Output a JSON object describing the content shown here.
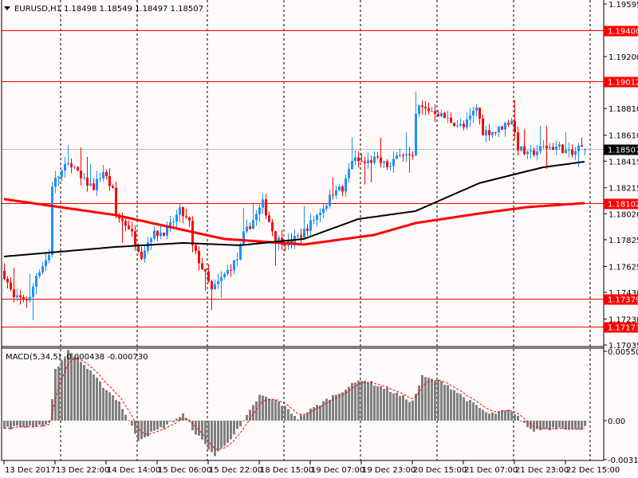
{
  "header": {
    "symbol": "EURUSD,H1",
    "ohlc": "1.18498 1.18549 1.18497 1.18507",
    "menu_icon": "triangle-down-icon"
  },
  "colors": {
    "background": "#fffafa",
    "bull": "#1e90ff",
    "bear": "#ff0000",
    "level": "#ff0000",
    "ma_slow": "#ff0000",
    "ma_fast": "#000000",
    "macd_hist": "#808080",
    "macd_signal": "#ff0000",
    "current_price": "#c0c0c0"
  },
  "chart_data": {
    "type": "candlestick",
    "symbol": "EURUSD",
    "timeframe": "H1",
    "bars": 183,
    "ylim": [
      1.17035,
      1.19595
    ],
    "y_ticks": [
      "1.19595",
      "1.19200",
      "1.18810",
      "1.18610",
      "1.18415",
      "1.18215",
      "1.18020",
      "1.17825",
      "1.17625",
      "1.17430",
      "1.17230",
      "1.17035"
    ],
    "x_ticks": [
      {
        "bar": 0,
        "label": "13 Dec 2017"
      },
      {
        "bar": 16,
        "label": "13 Dec 22:00"
      },
      {
        "bar": 32,
        "label": "14 Dec 14:00"
      },
      {
        "bar": 48,
        "label": "15 Dec 06:00"
      },
      {
        "bar": 64,
        "label": "15 Dec 22:00"
      },
      {
        "bar": 80,
        "label": "18 Dec 15:00"
      },
      {
        "bar": 96,
        "label": "19 Dec 07:00"
      },
      {
        "bar": 112,
        "label": "19 Dec 23:00"
      },
      {
        "bar": 128,
        "label": "20 Dec 15:00"
      },
      {
        "bar": 144,
        "label": "21 Dec 07:00"
      },
      {
        "bar": 160,
        "label": "21 Dec 23:00"
      },
      {
        "bar": 176,
        "label": "22 Dec 15:00"
      }
    ],
    "day_separators": [
      18,
      42,
      64,
      88,
      112,
      136,
      160,
      184
    ],
    "close_path": [
      [
        0,
        1.17562
      ],
      [
        3,
        1.17382
      ],
      [
        8,
        1.17382
      ],
      [
        10,
        1.17562
      ],
      [
        14,
        1.17711
      ],
      [
        15,
        1.18238
      ],
      [
        19,
        1.18369
      ],
      [
        21,
        1.18399
      ],
      [
        24,
        1.18279
      ],
      [
        28,
        1.1822
      ],
      [
        31,
        1.18339
      ],
      [
        34,
        1.1819
      ],
      [
        35,
        1.1801
      ],
      [
        39,
        1.17921
      ],
      [
        43,
        1.17711
      ],
      [
        46,
        1.17861
      ],
      [
        51,
        1.17891
      ],
      [
        55,
        1.1804
      ],
      [
        58,
        1.1795
      ],
      [
        59,
        1.17771
      ],
      [
        63,
        1.17562
      ],
      [
        65,
        1.17442
      ],
      [
        69,
        1.17562
      ],
      [
        73,
        1.17681
      ],
      [
        75,
        1.17861
      ],
      [
        79,
        1.1801
      ],
      [
        81,
        1.181
      ],
      [
        85,
        1.17831
      ],
      [
        89,
        1.17801
      ],
      [
        93,
        1.17861
      ],
      [
        96,
        1.1795
      ],
      [
        99,
        1.1804
      ],
      [
        101,
        1.181
      ],
      [
        104,
        1.1822
      ],
      [
        106,
        1.1819
      ],
      [
        109,
        1.18429
      ],
      [
        113,
        1.18399
      ],
      [
        116,
        1.18429
      ],
      [
        121,
        1.18369
      ],
      [
        124,
        1.18489
      ],
      [
        128,
        1.18429
      ],
      [
        129,
        1.18758
      ],
      [
        130,
        1.18818
      ],
      [
        135,
        1.18788
      ],
      [
        139,
        1.18728
      ],
      [
        144,
        1.18668
      ],
      [
        148,
        1.18818
      ],
      [
        150,
        1.18638
      ],
      [
        154,
        1.18638
      ],
      [
        159,
        1.18728
      ],
      [
        161,
        1.18519
      ],
      [
        164,
        1.18459
      ],
      [
        169,
        1.18519
      ],
      [
        174,
        1.18519
      ],
      [
        178,
        1.18459
      ],
      [
        180,
        1.18519
      ],
      [
        182,
        1.18507
      ]
    ],
    "ma_slow": [
      [
        0,
        1.1813
      ],
      [
        35,
        1.1801
      ],
      [
        69,
        1.17831
      ],
      [
        94,
        1.17789
      ],
      [
        116,
        1.17861
      ],
      [
        129,
        1.1795
      ],
      [
        149,
        1.18022
      ],
      [
        164,
        1.1807
      ],
      [
        182,
        1.181
      ]
    ],
    "ma_fast": [
      [
        0,
        1.17699
      ],
      [
        35,
        1.17771
      ],
      [
        56,
        1.17801
      ],
      [
        74,
        1.17783
      ],
      [
        94,
        1.17831
      ],
      [
        111,
        1.1798
      ],
      [
        129,
        1.1804
      ],
      [
        149,
        1.1825
      ],
      [
        169,
        1.18369
      ],
      [
        182,
        1.18411
      ]
    ],
    "levels": [
      "1.19400",
      "1.19012",
      "1.18102",
      "1.17379",
      "1.17171"
    ],
    "current_price": "1.18507",
    "macd": {
      "label": "MACD(5,34,5)",
      "value": "-0.000438",
      "signal_value": "-0.000730",
      "ylim": [
        -0.003102,
        0.005509
      ],
      "y_ticks": [
        "0.005509",
        "0.00",
        "-0.003102"
      ],
      "hist_path": [
        [
          0,
          -0.0006
        ],
        [
          14,
          -0.0003
        ],
        [
          16,
          0.004
        ],
        [
          20,
          0.0055
        ],
        [
          23,
          0.005
        ],
        [
          30,
          0.003
        ],
        [
          36,
          0.0015
        ],
        [
          42,
          -0.0015
        ],
        [
          50,
          -0.0005
        ],
        [
          56,
          0.0005
        ],
        [
          60,
          -0.001
        ],
        [
          66,
          -0.0028
        ],
        [
          74,
          -0.0005
        ],
        [
          80,
          0.002
        ],
        [
          86,
          0.0015
        ],
        [
          92,
          0.0002
        ],
        [
          100,
          0.0015
        ],
        [
          108,
          0.0027
        ],
        [
          112,
          0.0033
        ],
        [
          120,
          0.0025
        ],
        [
          128,
          0.0015
        ],
        [
          131,
          0.0035
        ],
        [
          138,
          0.003
        ],
        [
          146,
          0.0015
        ],
        [
          152,
          0.0005
        ],
        [
          158,
          0.0008
        ],
        [
          162,
          0.0001
        ],
        [
          165,
          -0.0008
        ],
        [
          175,
          -0.0005
        ],
        [
          180,
          -0.0008
        ],
        [
          182,
          -0.000438
        ]
      ]
    }
  }
}
